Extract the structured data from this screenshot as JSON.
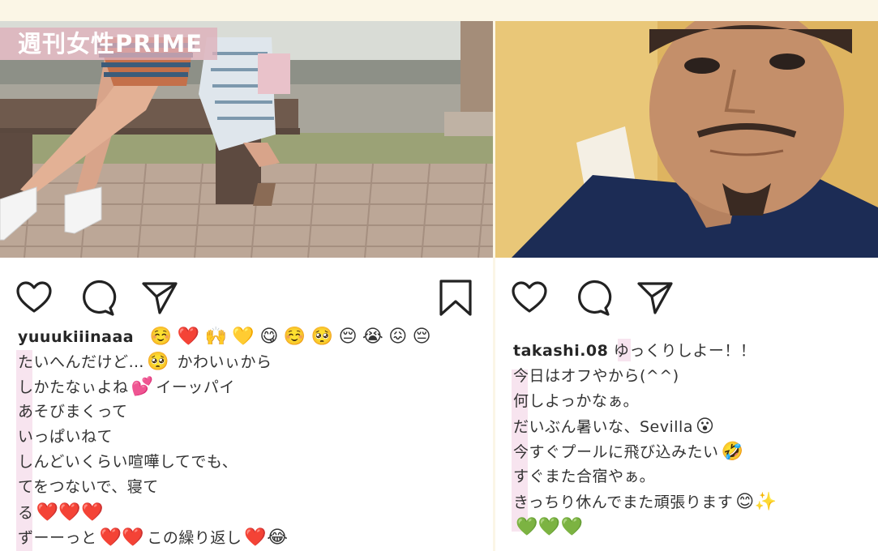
{
  "watermark": "週刊女性PRIME",
  "left_post": {
    "username": "yuuukiiinaaa",
    "emoji_line": [
      "☺️",
      "❤️",
      "🙌",
      "💛",
      "😋",
      "☺️",
      "🥺",
      "😔",
      "😭",
      "😖",
      "😔"
    ],
    "lines": [
      {
        "text": "たいへんだけど…",
        "emoji_after": "🥺",
        "text2": " かわいぃから"
      },
      {
        "text": "しかたなぃよね",
        "emoji_after": "💕",
        "text2": "イーッパイ"
      },
      {
        "text": "あそびまくって"
      },
      {
        "text": "いっぱいねて"
      },
      {
        "text": "しんどいくらい喧嘩してでも、"
      },
      {
        "text": "てをつないで、寝て"
      },
      {
        "text": "る",
        "emoji_after": "❤️❤️❤️",
        "text2": ""
      },
      {
        "text": "ずーーっと",
        "emoji_after": "❤️❤️",
        "text2": "この繰り返し",
        "emoji_after2": "❤️😂"
      }
    ]
  },
  "right_post": {
    "username": "takashi.08",
    "first_text": " ゆっくりしよー！！",
    "lines": [
      {
        "text": "今日はオフやから(^^)"
      },
      {
        "text": "何しよっかなぁ。"
      },
      {
        "text": "だいぶん暑いな、Sevilla",
        "emoji_after": "😮"
      },
      {
        "text": "今すぐプールに飛び込みたい",
        "emoji_after": "🤣"
      },
      {
        "text": "すぐまた合宿やぁ。"
      },
      {
        "text": "きっちり休んでまた頑張ります",
        "emoji_after": "😊✨"
      },
      {
        "text": "",
        "emoji_after": "💚💚💚"
      }
    ]
  },
  "icons": {
    "like": "heart-icon",
    "comment": "comment-icon",
    "share": "share-icon",
    "save": "bookmark-icon"
  }
}
